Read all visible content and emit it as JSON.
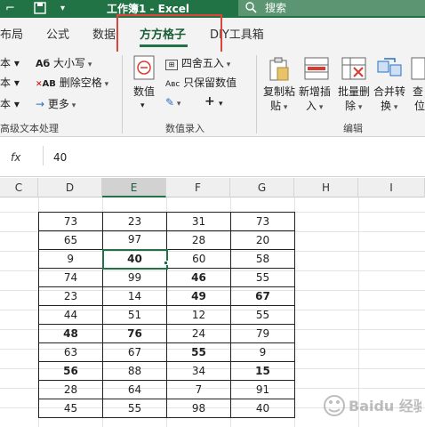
{
  "titlebar": {
    "title": "工作簿1  -  Excel",
    "search_label": "搜索"
  },
  "tabs": [
    {
      "label": "布局"
    },
    {
      "label": "公式"
    },
    {
      "label": "数据"
    },
    {
      "label": "方方格子"
    },
    {
      "label": "DIY工具箱"
    }
  ],
  "ribbon": {
    "left_items": {
      "row1_partial": "本 ▾",
      "row2_partial": "本 ▾",
      "row3_partial": "本 ▾",
      "size_label": "大小写",
      "remove_spaces_label": "删除空格",
      "more_label": "更多",
      "group_label": "高级文本处理"
    },
    "numeric": {
      "value_label": "数值",
      "round_label": "四舍五入",
      "keep_numeric_label": "只保留数值",
      "plus_symbol": "+",
      "group_label": "数值录入"
    },
    "edit": {
      "copy_paste_label_1": "复制粘",
      "copy_paste_label_2": "贴",
      "insert_label_1": "新增插",
      "insert_label_2": "入",
      "batch_delete_label_1": "批量删",
      "batch_delete_label_2": "除",
      "merge_convert_label_1": "合并转",
      "merge_convert_label_2": "换",
      "find_label_1": "查",
      "find_label_2": "位",
      "group_label": "编辑"
    }
  },
  "formula_bar": {
    "fx_label": "fx",
    "value": "40"
  },
  "columns": [
    "C",
    "D",
    "E",
    "F",
    "G",
    "H",
    "I"
  ],
  "table": {
    "rows": [
      [
        "73",
        "23",
        "31",
        "73"
      ],
      [
        "65",
        "97",
        "28",
        "20"
      ],
      [
        "9",
        "40",
        "60",
        "58"
      ],
      [
        "74",
        "99",
        "46",
        "55"
      ],
      [
        "23",
        "14",
        "49",
        "67"
      ],
      [
        "44",
        "51",
        "12",
        "55"
      ],
      [
        "48",
        "76",
        "24",
        "79"
      ],
      [
        "63",
        "67",
        "55",
        "9"
      ],
      [
        "56",
        "88",
        "34",
        "15"
      ],
      [
        "28",
        "64",
        "7",
        "91"
      ],
      [
        "45",
        "55",
        "98",
        "40"
      ]
    ],
    "bold_cells": [
      [
        2,
        1
      ],
      [
        3,
        2
      ],
      [
        4,
        2
      ],
      [
        4,
        3
      ],
      [
        6,
        0
      ],
      [
        6,
        1
      ],
      [
        7,
        2
      ],
      [
        8,
        0
      ],
      [
        8,
        3
      ]
    ],
    "active_cell": [
      2,
      1
    ]
  },
  "watermark_text": "Baidu 经验",
  "colors": {
    "excel_green": "#217346",
    "highlight_red": "#e0433a"
  }
}
